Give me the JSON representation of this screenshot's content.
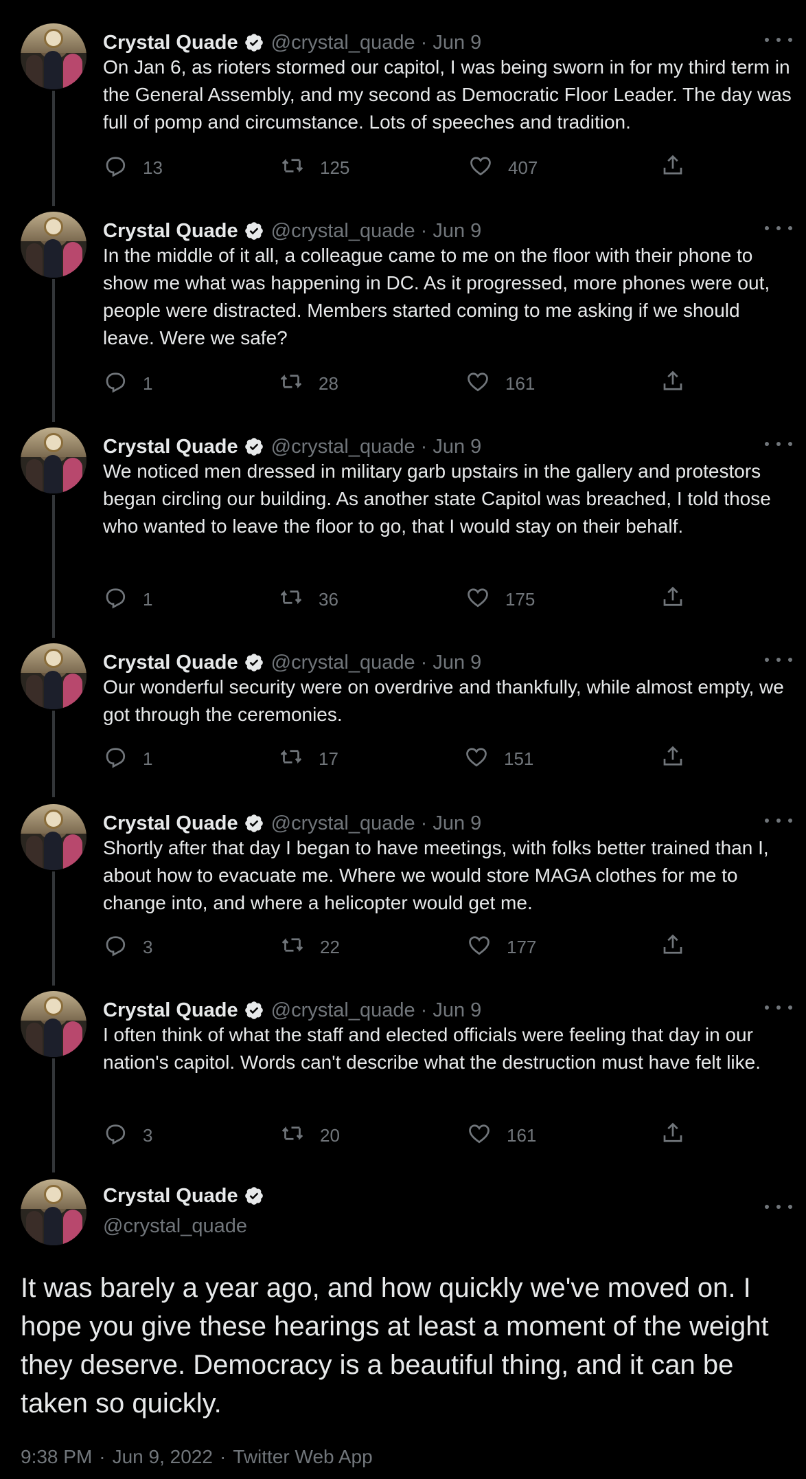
{
  "author": {
    "name": "Crystal Quade",
    "handle": "@crystal_quade",
    "separator": "·"
  },
  "tweets": [
    {
      "date": "Jun 9",
      "text": "On Jan 6, as rioters stormed our capitol, I was being sworn in for my third term in the General Assembly, and my second as Democratic Floor Leader. The day was full of pomp and circumstance. Lots of speeches and tradition.",
      "replies": "13",
      "retweets": "125",
      "likes": "407"
    },
    {
      "date": "Jun 9",
      "text": "In the middle of it all, a colleague came to me on the floor with their phone to show me what was happening in DC. As it progressed, more phones were out, people were distracted. Members started coming to me asking if we should leave. Were we safe?",
      "replies": "1",
      "retweets": "28",
      "likes": "161"
    },
    {
      "date": "Jun 9",
      "text": "We noticed men dressed in military garb upstairs in the gallery and protestors began circling our building. As another state Capitol was breached, I told those who wanted to leave the floor to go, that I would stay on their behalf.",
      "replies": "1",
      "retweets": "36",
      "likes": "175"
    },
    {
      "date": "Jun 9",
      "text": "Our wonderful security were on overdrive and thankfully, while almost empty, we got through the ceremonies.",
      "replies": "1",
      "retweets": "17",
      "likes": "151"
    },
    {
      "date": "Jun 9",
      "text": "Shortly after that day I began to have meetings, with folks better trained than I, about how to evacuate me. Where we would store MAGA clothes for me to change into, and where a helicopter would get me.",
      "replies": "3",
      "retweets": "22",
      "likes": "177"
    },
    {
      "date": "Jun 9",
      "text": "I often think of what the staff and elected officials were feeling that day in our nation's capitol. Words can't describe what the destruction must have felt like.",
      "replies": "3",
      "retweets": "20",
      "likes": "161"
    }
  ],
  "main_tweet": {
    "text": "It was barely a year ago, and how quickly we've moved on. I hope you give these hearings at least a moment of the weight they deserve. Democracy is a beautiful thing, and it can be taken so quickly.",
    "time": "9:38 PM",
    "date": "Jun 9, 2022",
    "source": "Twitter Web App",
    "meta_separator": "·"
  },
  "colors": {
    "background": "#000000",
    "text": "#e7e9ea",
    "muted": "#71767b",
    "thread_line": "#333639",
    "verified_badge": "#e7e9ea"
  },
  "icons": [
    "reply-icon",
    "retweet-icon",
    "like-icon",
    "share-icon",
    "verified-icon",
    "more-icon"
  ]
}
